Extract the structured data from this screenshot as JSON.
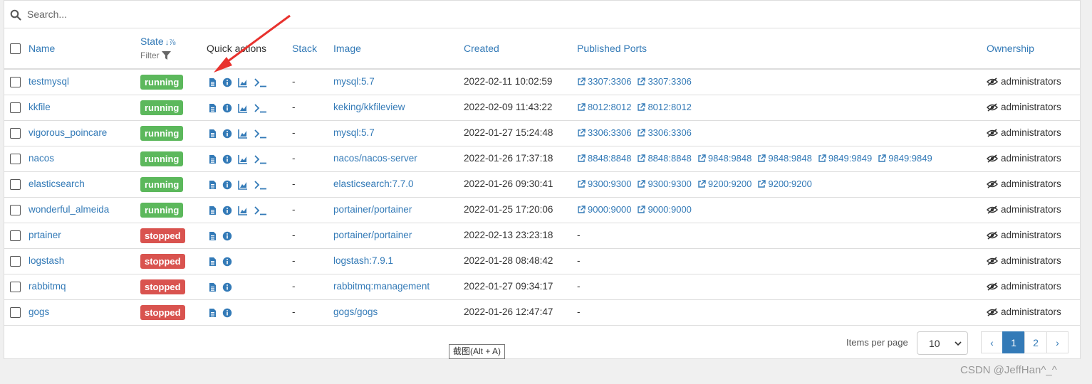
{
  "search": {
    "placeholder": "Search..."
  },
  "headers": {
    "name": "Name",
    "state": "State",
    "state_sort": "↓⅞",
    "filter": "Filter",
    "quick_actions": "Quick actions",
    "stack": "Stack",
    "image": "Image",
    "created": "Created",
    "published_ports": "Published Ports",
    "ownership": "Ownership"
  },
  "colors": {
    "running": "#5cb85c",
    "stopped": "#d9534f",
    "link": "#337ab7",
    "arrow": "#e8322e"
  },
  "rows": [
    {
      "name": "testmysql",
      "state": "running",
      "stack": "-",
      "image": "mysql:5.7",
      "created": "2022-02-11 10:02:59",
      "ports": [
        "3307:3306",
        "3307:3306"
      ],
      "ownership": "administrators"
    },
    {
      "name": "kkfile",
      "state": "running",
      "stack": "-",
      "image": "keking/kkfileview",
      "created": "2022-02-09 11:43:22",
      "ports": [
        "8012:8012",
        "8012:8012"
      ],
      "ownership": "administrators"
    },
    {
      "name": "vigorous_poincare",
      "state": "running",
      "stack": "-",
      "image": "mysql:5.7",
      "created": "2022-01-27 15:24:48",
      "ports": [
        "3306:3306",
        "3306:3306"
      ],
      "ownership": "administrators"
    },
    {
      "name": "nacos",
      "state": "running",
      "stack": "-",
      "image": "nacos/nacos-server",
      "created": "2022-01-26 17:37:18",
      "ports": [
        "8848:8848",
        "8848:8848",
        "9848:9848",
        "9848:9848",
        "9849:9849",
        "9849:9849"
      ],
      "ownership": "administrators"
    },
    {
      "name": "elasticsearch",
      "state": "running",
      "stack": "-",
      "image": "elasticsearch:7.7.0",
      "created": "2022-01-26 09:30:41",
      "ports": [
        "9300:9300",
        "9300:9300",
        "9200:9200",
        "9200:9200"
      ],
      "ownership": "administrators"
    },
    {
      "name": "wonderful_almeida",
      "state": "running",
      "stack": "-",
      "image": "portainer/portainer",
      "created": "2022-01-25 17:20:06",
      "ports": [
        "9000:9000",
        "9000:9000"
      ],
      "ownership": "administrators"
    },
    {
      "name": "prtainer",
      "state": "stopped",
      "stack": "-",
      "image": "portainer/portainer",
      "created": "2022-02-13 23:23:18",
      "ports_text": "-",
      "ownership": "administrators"
    },
    {
      "name": "logstash",
      "state": "stopped",
      "stack": "-",
      "image": "logstash:7.9.1",
      "created": "2022-01-28 08:48:42",
      "ports_text": "-",
      "ownership": "administrators"
    },
    {
      "name": "rabbitmq",
      "state": "stopped",
      "stack": "-",
      "image": "rabbitmq:management",
      "created": "2022-01-27 09:34:17",
      "ports_text": "-",
      "ownership": "administrators"
    },
    {
      "name": "gogs",
      "state": "stopped",
      "stack": "-",
      "image": "gogs/gogs",
      "created": "2022-01-26 12:47:47",
      "ports_text": "-",
      "ownership": "administrators"
    }
  ],
  "footer": {
    "items_per_page_label": "Items per page",
    "items_per_page_value": "10",
    "pager": {
      "prev": "‹",
      "pages": [
        "1",
        "2"
      ],
      "current": "1",
      "next": "›"
    }
  },
  "tooltip": "截图(Alt + A)",
  "watermark": "CSDN @JeffHan^_^"
}
